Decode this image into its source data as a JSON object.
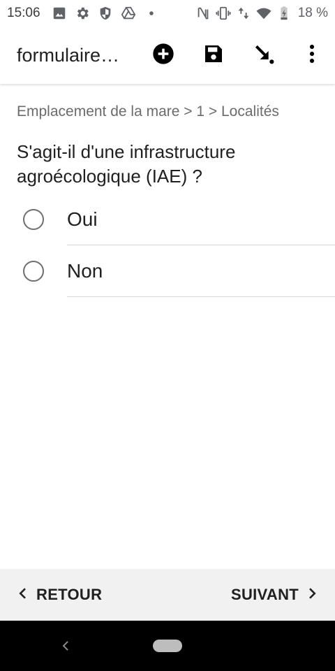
{
  "status_bar": {
    "time": "15:06",
    "left_icons": [
      "image-icon",
      "gear-icon",
      "shield-icon",
      "drive-icon",
      "dot-icon"
    ],
    "right_icons": [
      "nfc-icon",
      "vibrate-icon",
      "data-arrows-icon",
      "wifi-icon",
      "battery-icon"
    ],
    "battery": "18 %"
  },
  "app_bar": {
    "title": "formulaire…",
    "actions": [
      "add-circle-icon",
      "save-icon",
      "jump-icon",
      "more-vert-icon"
    ]
  },
  "breadcrumb": "Emplacement de la mare > 1 > Localités",
  "question": "S'agit-il d'une infrastructure agroécologique (IAE) ?",
  "options": [
    {
      "label": "Oui",
      "selected": false
    },
    {
      "label": "Non",
      "selected": false
    }
  ],
  "bottom_nav": {
    "back_label": "RETOUR",
    "next_label": "SUIVANT"
  },
  "colors": {
    "background": "#ffffff",
    "bottom_bar": "#f1f1f1",
    "text_primary": "#202020",
    "text_secondary": "#6b6b6b",
    "radio_border": "#6f6f6f",
    "system_nav": "#000000"
  }
}
